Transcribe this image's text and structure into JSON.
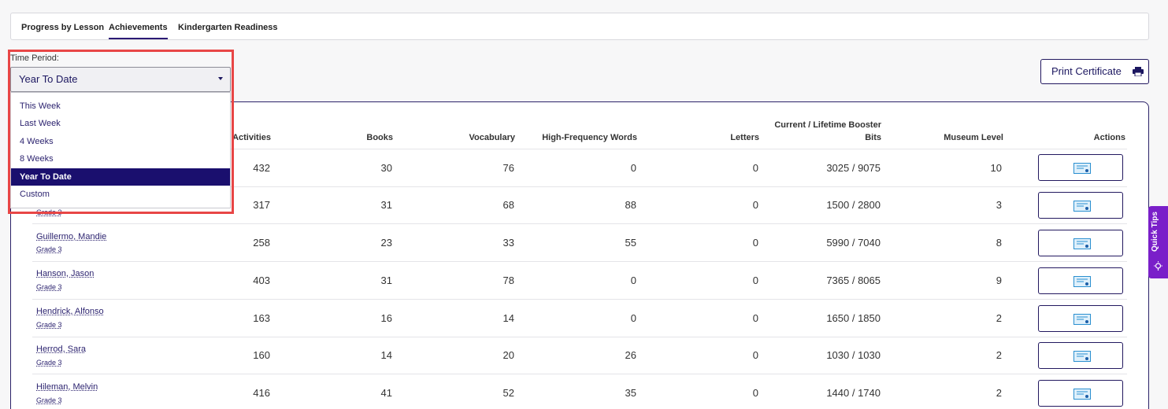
{
  "tabs": [
    {
      "label": "Progress by Lesson"
    },
    {
      "label": "Achievements"
    },
    {
      "label": "Kindergarten Readiness"
    }
  ],
  "time_period": {
    "label": "Time Period:",
    "selected": "Year To Date",
    "options": [
      "This Week",
      "Last Week",
      "4 Weeks",
      "8 Weeks",
      "Year To Date",
      "Custom"
    ]
  },
  "print_button": {
    "label": "Print Certificate"
  },
  "table": {
    "headers": {
      "activities": "Activities",
      "books": "Books",
      "vocabulary": "Vocabulary",
      "hfw": "High-Frequency Words",
      "letters": "Letters",
      "booster_line1": "Current / Lifetime Booster",
      "booster_line2": "Bits",
      "museum": "Museum Level",
      "actions": "Actions"
    },
    "rows": [
      {
        "name": "",
        "grade": "",
        "activities": "432",
        "books": "30",
        "vocabulary": "76",
        "hfw": "0",
        "letters": "0",
        "booster": "3025 / 9075",
        "museum": "10"
      },
      {
        "name": "",
        "grade": "Grade 3",
        "activities": "317",
        "books": "31",
        "vocabulary": "68",
        "hfw": "88",
        "letters": "0",
        "booster": "1500 / 2800",
        "museum": "3"
      },
      {
        "name": "Guillermo, Mandie",
        "grade": "Grade 3",
        "activities": "258",
        "books": "23",
        "vocabulary": "33",
        "hfw": "55",
        "letters": "0",
        "booster": "5990 / 7040",
        "museum": "8"
      },
      {
        "name": "Hanson, Jason",
        "grade": "Grade 3",
        "activities": "403",
        "books": "31",
        "vocabulary": "78",
        "hfw": "0",
        "letters": "0",
        "booster": "7365 / 8065",
        "museum": "9"
      },
      {
        "name": "Hendrick, Alfonso",
        "grade": "Grade 3",
        "activities": "163",
        "books": "16",
        "vocabulary": "14",
        "hfw": "0",
        "letters": "0",
        "booster": "1650 / 1850",
        "museum": "2"
      },
      {
        "name": "Herrod, Sara",
        "grade": "Grade 3",
        "activities": "160",
        "books": "14",
        "vocabulary": "20",
        "hfw": "26",
        "letters": "0",
        "booster": "1030 / 1030",
        "museum": "2"
      },
      {
        "name": "Hileman, Melvin",
        "grade": "Grade 3",
        "activities": "416",
        "books": "41",
        "vocabulary": "52",
        "hfw": "35",
        "letters": "0",
        "booster": "1440 / 1740",
        "museum": "2"
      }
    ]
  },
  "quick_tips": {
    "label": "Quick Tips"
  },
  "colors": {
    "brand": "#1a0f6e",
    "accent_purple": "#7a1fc9",
    "highlight_red": "#e84646"
  }
}
